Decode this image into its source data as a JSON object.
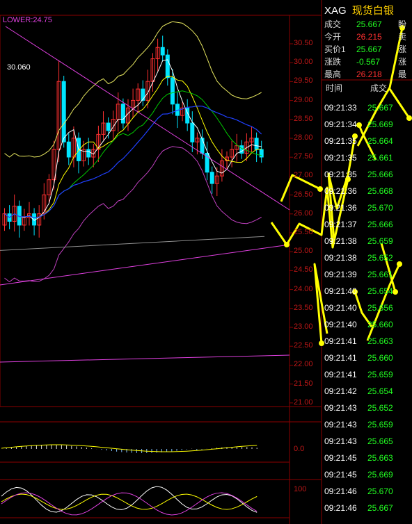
{
  "chart": {
    "lower_label": "LOWER:24.75",
    "peak_label": "30.060",
    "price_axis": [
      "30.50",
      "30.00",
      "29.50",
      "29.00",
      "28.50",
      "28.00",
      "27.50",
      "27.00",
      "26.50",
      "26.00",
      "25.50",
      "25.00",
      "24.50",
      "24.00",
      "23.50",
      "23.00",
      "22.50",
      "22.00",
      "21.50",
      "21.00"
    ],
    "macd_axis": "0.0",
    "rsi_axis": "100"
  },
  "colors": {
    "background": "#000000",
    "grid": "#8b0000",
    "up_candle": "#ff3030",
    "down_candle": "#00e5ff",
    "trendline": "#e040e0",
    "annotation_arrow": "#ffff00",
    "tick_price": "#22ff22",
    "symbol_name": "#ffd000"
  },
  "quote_panel": {
    "symbol": "XAG",
    "name": "现货白银",
    "rows": [
      {
        "label": "成交",
        "value": "25.667",
        "color": "#22ff22",
        "extra": "盼"
      },
      {
        "label": "今开",
        "value": "26.215",
        "color": "#ff3030",
        "extra": "卖"
      },
      {
        "label": "买价1",
        "value": "25.667",
        "color": "#22ff22",
        "extra": "涨"
      },
      {
        "label": "涨跌",
        "value": "-0.567",
        "color": "#22ff22",
        "extra": "涨"
      },
      {
        "label": "最高",
        "value": "26.218",
        "color": "#ff3030",
        "extra": "最"
      }
    ]
  },
  "ticks": {
    "header_time": "时间",
    "header_price": "成交",
    "rows": [
      {
        "time": "09:21:33",
        "price": "25.667"
      },
      {
        "time": "09:21:34",
        "price": "25.669"
      },
      {
        "time": "09:21:35",
        "price": "25.664"
      },
      {
        "time": "09:21:35",
        "price": "25.661"
      },
      {
        "time": "09:21:35",
        "price": "25.666"
      },
      {
        "time": "09:21:36",
        "price": "25.668"
      },
      {
        "time": "09:21:36",
        "price": "25.670"
      },
      {
        "time": "09:21:37",
        "price": "25.666"
      },
      {
        "time": "09:21:38",
        "price": "25.659"
      },
      {
        "time": "09:21:38",
        "price": "25.652"
      },
      {
        "time": "09:21:39",
        "price": "25.661"
      },
      {
        "time": "09:21:40",
        "price": "25.654"
      },
      {
        "time": "09:21:40",
        "price": "25.656"
      },
      {
        "time": "09:21:40",
        "price": "25.660"
      },
      {
        "time": "09:21:41",
        "price": "25.663"
      },
      {
        "time": "09:21:41",
        "price": "25.660"
      },
      {
        "time": "09:21:41",
        "price": "25.659"
      },
      {
        "time": "09:21:42",
        "price": "25.654"
      },
      {
        "time": "09:21:43",
        "price": "25.652"
      },
      {
        "time": "09:21:43",
        "price": "25.659"
      },
      {
        "time": "09:21:43",
        "price": "25.665"
      },
      {
        "time": "09:21:45",
        "price": "25.663"
      },
      {
        "time": "09:21:45",
        "price": "25.669"
      },
      {
        "time": "09:21:46",
        "price": "25.670"
      },
      {
        "time": "09:21:46",
        "price": "25.667"
      }
    ]
  }
}
